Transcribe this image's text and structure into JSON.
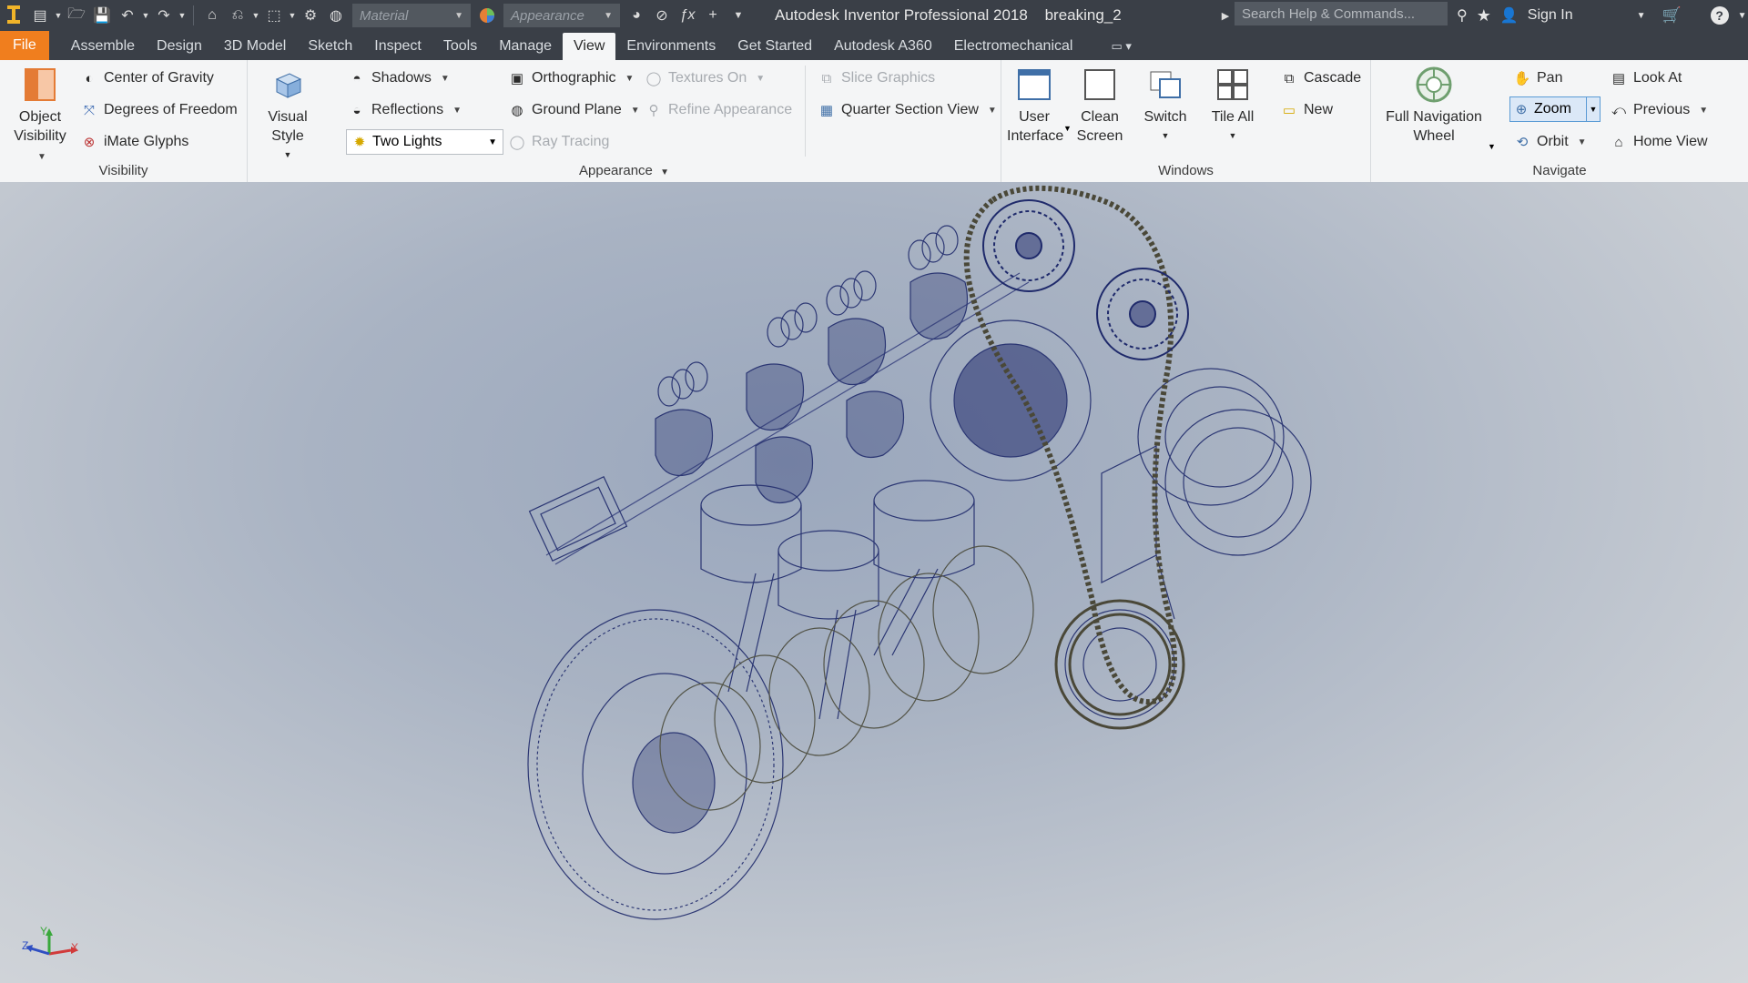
{
  "app": {
    "title": "Autodesk Inventor Professional 2018",
    "document": "breaking_2",
    "material_placeholder": "Material",
    "appearance_placeholder": "Appearance",
    "search_placeholder": "Search Help & Commands...",
    "sign_in": "Sign In",
    "accent": "#f07e1e"
  },
  "tabs": [
    "File",
    "Assemble",
    "Design",
    "3D Model",
    "Sketch",
    "Inspect",
    "Tools",
    "Manage",
    "View",
    "Environments",
    "Get Started",
    "Autodesk A360",
    "Electromechanical"
  ],
  "active_tab": "View",
  "ribbon": {
    "visibility": {
      "title": "Visibility",
      "object_visibility": "Object Visibility",
      "center_of_gravity": "Center of Gravity",
      "degrees_of_freedom": "Degrees of Freedom",
      "imate_glyphs": "iMate Glyphs"
    },
    "appearance": {
      "title": "Appearance",
      "visual_style": "Visual Style",
      "shadows": "Shadows",
      "reflections": "Reflections",
      "lighting_value": "Two Lights",
      "orthographic": "Orthographic",
      "ground_plane": "Ground Plane",
      "textures_on": "Textures On",
      "refine_appearance": "Refine Appearance",
      "ray_tracing": "Ray Tracing",
      "slice_graphics": "Slice Graphics",
      "quarter_section_view": "Quarter Section View"
    },
    "windows": {
      "title": "Windows",
      "user_interface": "User Interface",
      "clean_screen": "Clean Screen",
      "switch": "Switch",
      "tile_all": "Tile All",
      "cascade": "Cascade",
      "new": "New"
    },
    "navigate": {
      "title": "Navigate",
      "full_navigation_wheel": "Full Navigation Wheel",
      "pan": "Pan",
      "zoom": "Zoom",
      "orbit": "Orbit",
      "look_at": "Look At",
      "previous": "Previous",
      "home_view": "Home View"
    }
  },
  "triad": {
    "x": "X",
    "y": "Y",
    "z": "Z"
  }
}
